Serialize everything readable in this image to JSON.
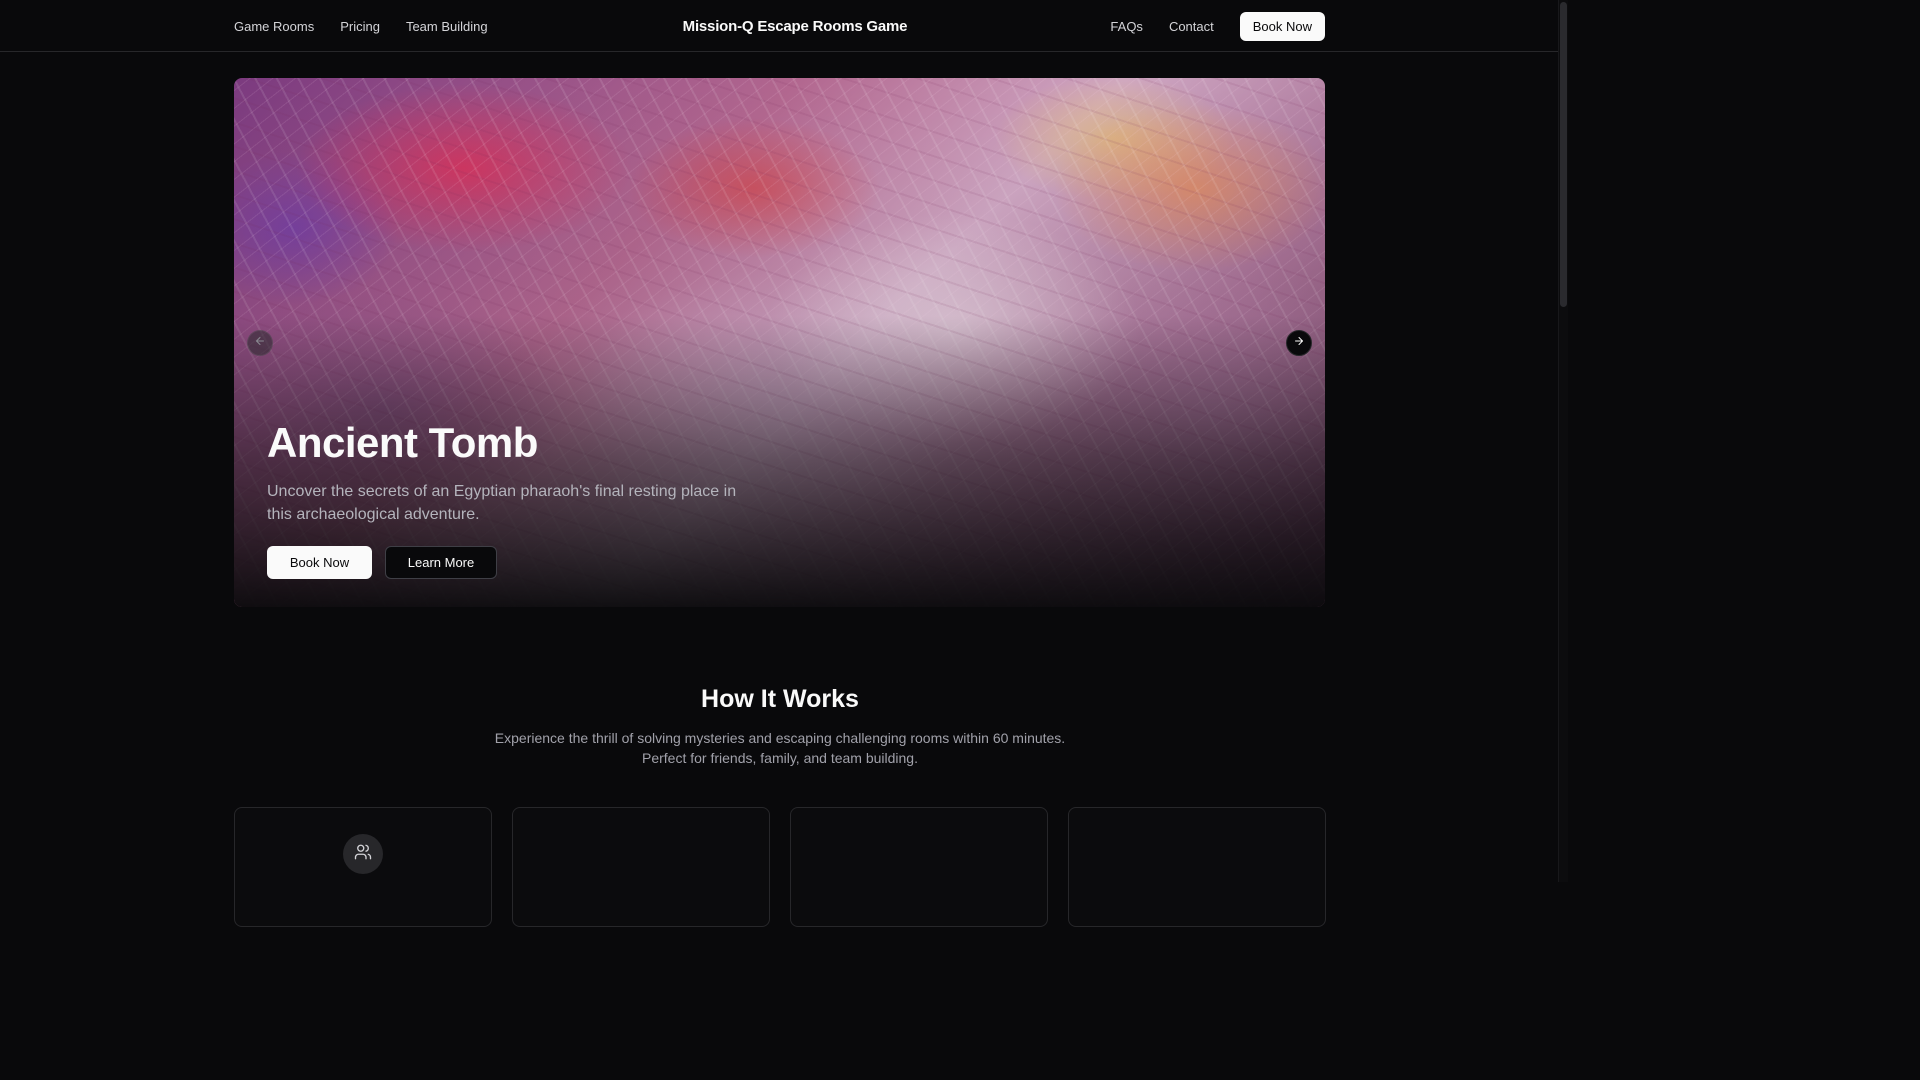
{
  "header": {
    "nav_left": [
      "Game Rooms",
      "Pricing",
      "Team Building"
    ],
    "brand": "Mission-Q Escape Rooms Game",
    "nav_right": [
      "FAQs",
      "Contact"
    ],
    "book_button": "Book Now"
  },
  "hero": {
    "title": "Ancient Tomb",
    "description": "Uncover the secrets of an Egyptian pharaoh's final resting place in this archaeological adventure.",
    "primary_button": "Book Now",
    "secondary_button": "Learn More",
    "prev_icon": "arrow-left-icon",
    "next_icon": "arrow-right-icon"
  },
  "how_it_works": {
    "title": "How It Works",
    "subtitle_line1": "Experience the thrill of solving mysteries and escaping challenging rooms within 60 minutes.",
    "subtitle_line2": "Perfect for friends, family, and team building.",
    "card_icon": "users-icon"
  },
  "colors": {
    "background": "#09090b",
    "foreground": "#fafafa",
    "muted": "#a1a1aa",
    "border": "#27272a"
  }
}
